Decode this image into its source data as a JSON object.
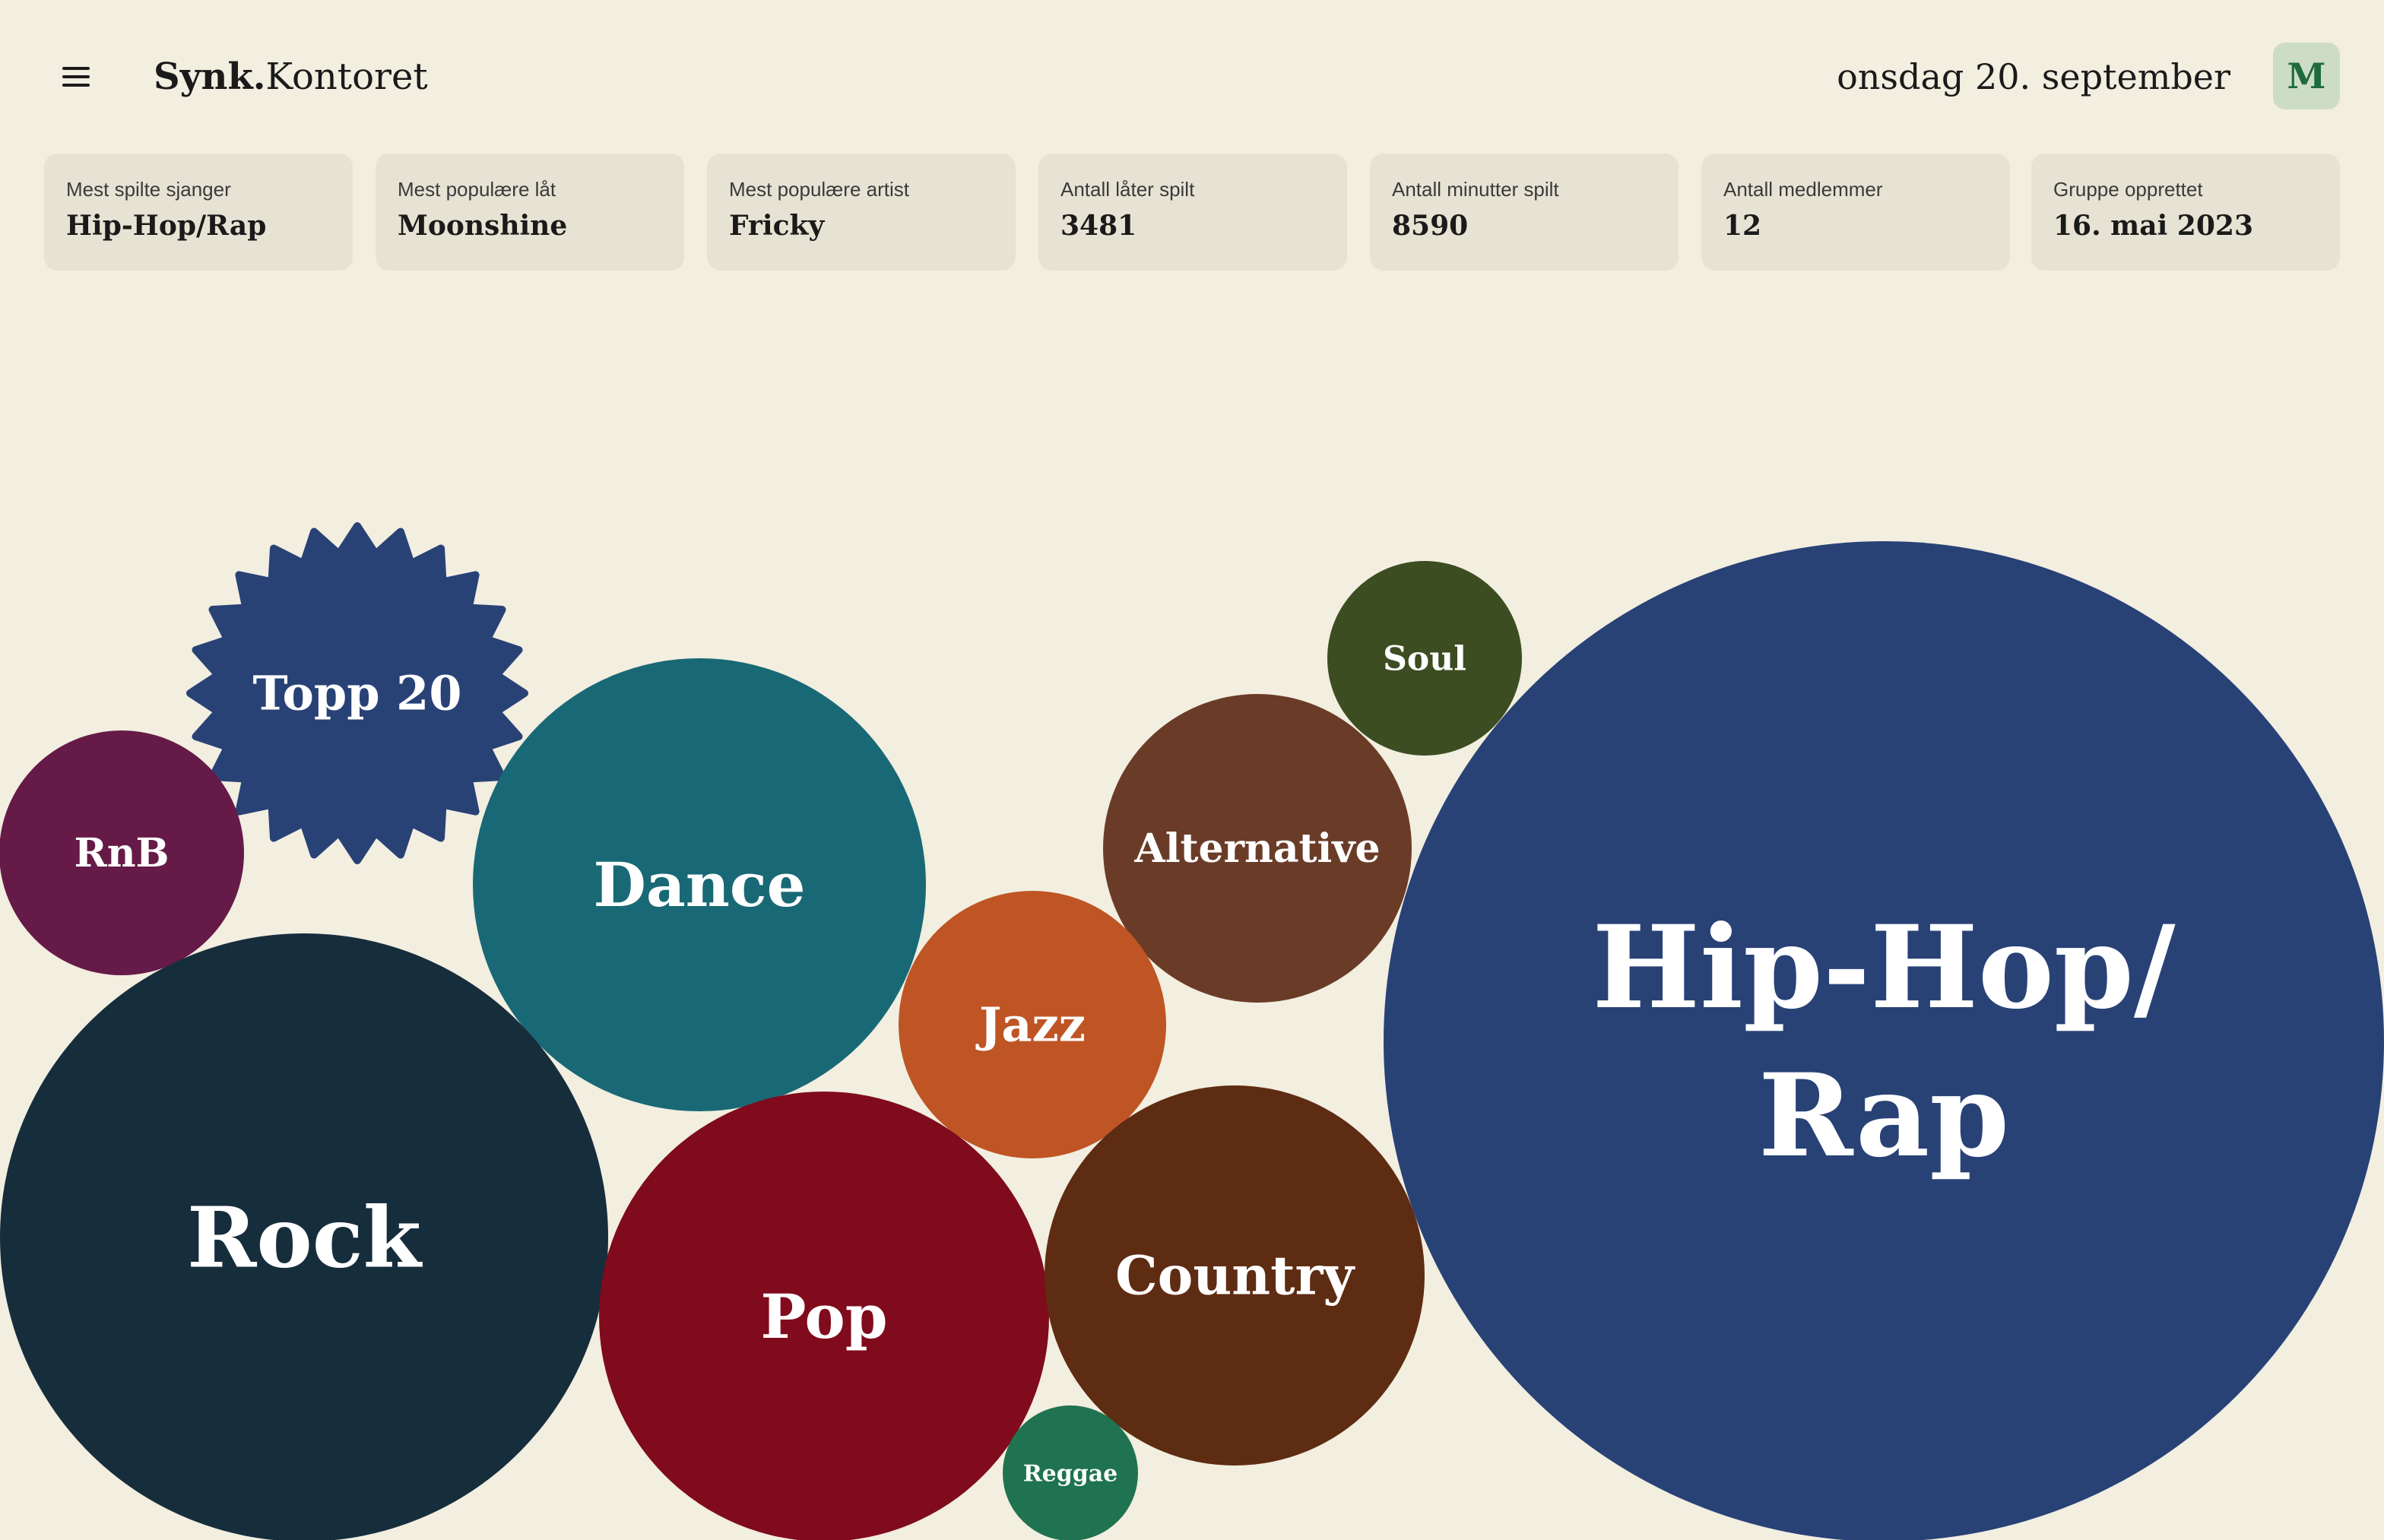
{
  "header": {
    "brand_bold": "Synk.",
    "brand_rest": "Kontoret",
    "date": "onsdag 20. september",
    "avatar_initial": "M"
  },
  "stats": [
    {
      "label": "Mest spilte sjanger",
      "value": "Hip-Hop/Rap"
    },
    {
      "label": "Mest populære låt",
      "value": "Moonshine"
    },
    {
      "label": "Mest populære artist",
      "value": "Fricky"
    },
    {
      "label": "Antall låter spilt",
      "value": "3481"
    },
    {
      "label": "Antall minutter spilt",
      "value": "8590"
    },
    {
      "label": "Antall medlemmer",
      "value": "12"
    },
    {
      "label": "Gruppe opprettet",
      "value": "16. mai 2023"
    }
  ],
  "genres": [
    {
      "name": "Topp 20",
      "color": "#284276",
      "shape": "starburst"
    },
    {
      "name": "RnB",
      "color": "#661a47",
      "shape": "circle"
    },
    {
      "name": "Dance",
      "color": "#186975",
      "shape": "circle"
    },
    {
      "name": "Soul",
      "color": "#3c4d22",
      "shape": "circle"
    },
    {
      "name": "Alternative",
      "color": "#6a3c28",
      "shape": "circle"
    },
    {
      "name": "Jazz",
      "color": "#bf5524",
      "shape": "circle"
    },
    {
      "name": "Hip-Hop/Rap",
      "lines": [
        "Hip-Hop/",
        "Rap"
      ],
      "color": "#284276",
      "shape": "circle"
    },
    {
      "name": "Rock",
      "color": "#162d3c",
      "shape": "circle"
    },
    {
      "name": "Pop",
      "color": "#7f0b1c",
      "shape": "circle"
    },
    {
      "name": "Country",
      "color": "#5e2c12",
      "shape": "circle"
    },
    {
      "name": "Reggae",
      "color": "#1f7350",
      "shape": "circle"
    }
  ]
}
